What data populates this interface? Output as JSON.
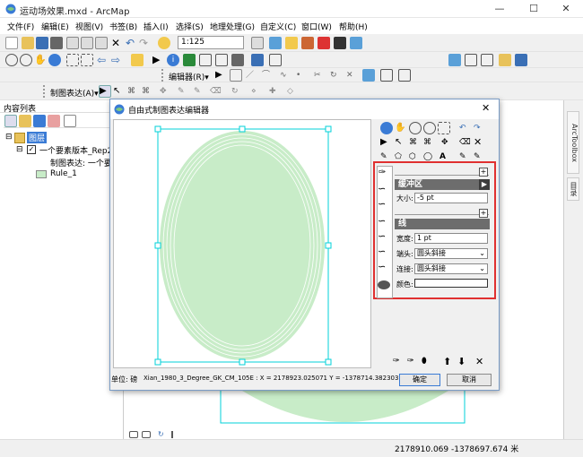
{
  "window": {
    "title": "运动场效果.mxd - ArcMap",
    "minimize": "—",
    "maximize": "☐",
    "close": "✕"
  },
  "menus": [
    "文件(F)",
    "编辑(E)",
    "视图(V)",
    "书签(B)",
    "插入(I)",
    "选择(S)",
    "地理处理(G)",
    "自定义(C)",
    "窗口(W)",
    "帮助(H)"
  ],
  "toolbar": {
    "scale": "1:125",
    "editor_label": "编辑器(R)▾",
    "representation_label": "制图表达(A)▾"
  },
  "toc": {
    "title": "内容列表",
    "layers_label": "图层",
    "layer_name": "一个要素版本_Rep2",
    "representation_label": "制图表达: 一个要",
    "rule_label": "Rule_1"
  },
  "dock": {
    "arctoolbox": "ArcToolbox",
    "catalog": "目录"
  },
  "dialog": {
    "title": "自由式制图表达编辑器",
    "close": "✕",
    "buffer_header": "缓冲区",
    "size_label": "大小:",
    "size_value": "-5 pt",
    "line_header": "线",
    "width_label": "宽度:",
    "width_value": "1 pt",
    "cap_label": "端头:",
    "cap_value": "圆头斜接",
    "join_label": "连接:",
    "join_value": "圆头斜接",
    "color_label": "颜色:",
    "plus": "+",
    "status_units": "单位: 磅",
    "status_coords": "Xian_1980_3_Degree_GK_CM_105E : X = 2178923.025071  Y = -1378714.382303",
    "ok": "确定",
    "cancel": "取消",
    "up": "⬆",
    "down": "⬇",
    "delete": "✕"
  },
  "status": {
    "coords": "2178910.069  -1378697.674 米"
  },
  "colors": {
    "fill": "#c8ecc8",
    "outline": "#00d2d8",
    "highlight": "#e03030",
    "header": "#6d6d6d"
  }
}
